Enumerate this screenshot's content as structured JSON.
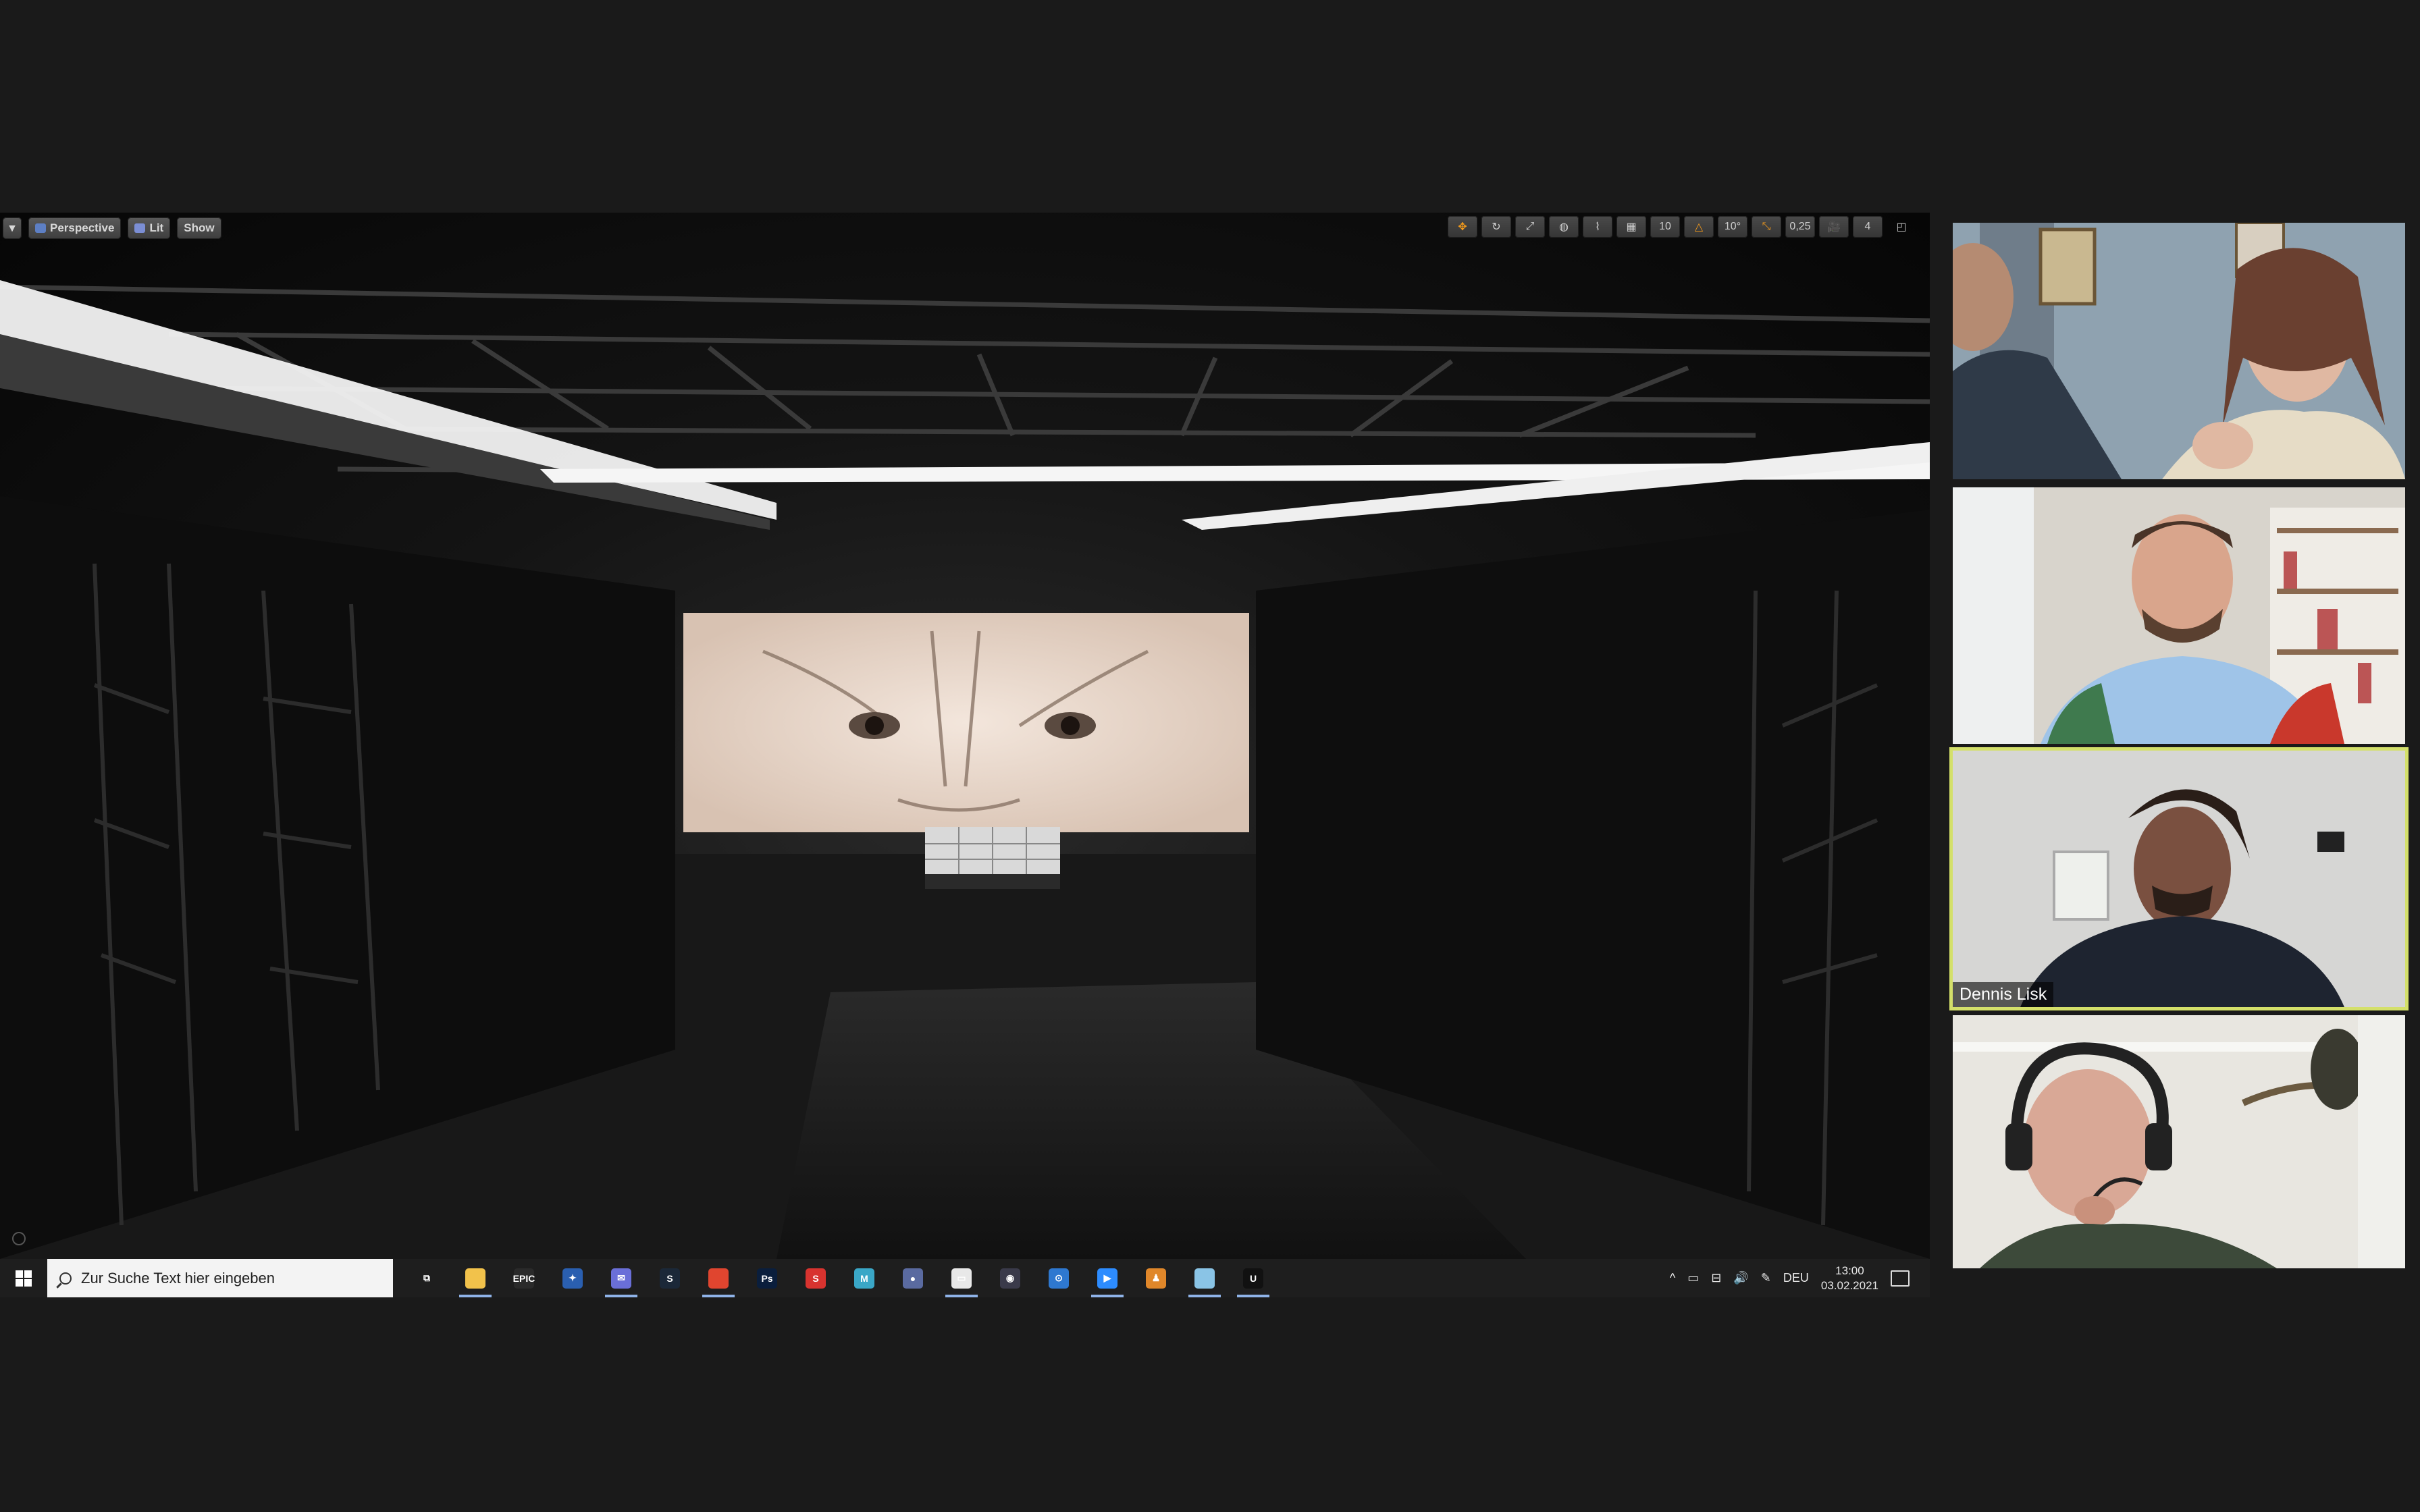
{
  "viewport": {
    "toolbar_left": {
      "dropdown_icon": "chevron-down-icon",
      "perspective_label": "Perspective",
      "lit_label": "Lit",
      "show_label": "Show"
    },
    "toolbar_right": {
      "grid_snap": "10",
      "rotation_snap": "10°",
      "scale_snap": "0,25",
      "camera_speed": "4"
    }
  },
  "taskbar": {
    "search_placeholder": "Zur Suche Text hier eingeben",
    "language": "DEU",
    "time": "13:00",
    "date": "03.02.2021",
    "apps": [
      {
        "name": "task-view-icon",
        "label": "⧉",
        "color": "#1e1e1e"
      },
      {
        "name": "file-explorer-icon",
        "label": "",
        "color": "#f2c24b",
        "active": true
      },
      {
        "name": "epic-games-icon",
        "label": "EPIC",
        "color": "#2a2a2a"
      },
      {
        "name": "app-blue-gear-icon",
        "label": "✦",
        "color": "#2a5fb0"
      },
      {
        "name": "mail-icon",
        "label": "✉",
        "color": "#6a6fd8",
        "active": true
      },
      {
        "name": "steam-icon",
        "label": "S",
        "color": "#1b2838"
      },
      {
        "name": "chrome-icon",
        "label": "",
        "color": "#e0452f",
        "active": true
      },
      {
        "name": "photoshop-icon",
        "label": "Ps",
        "color": "#0a1e3c"
      },
      {
        "name": "substance-icon",
        "label": "S",
        "color": "#d8332f"
      },
      {
        "name": "m-app-icon",
        "label": "M",
        "color": "#3aa7c7"
      },
      {
        "name": "obs-icon",
        "label": "●",
        "color": "#5a6aa0"
      },
      {
        "name": "oculus-icon",
        "label": "▭",
        "color": "#e8e8e8",
        "active": true
      },
      {
        "name": "app-dark-icon",
        "label": "◉",
        "color": "#3a3a4a"
      },
      {
        "name": "app-blue-circle-icon",
        "label": "⊙",
        "color": "#2e78d0"
      },
      {
        "name": "zoom-icon",
        "label": "▶",
        "color": "#2d8cff",
        "active": true
      },
      {
        "name": "app-orange-icon",
        "label": "♟",
        "color": "#e0872a"
      },
      {
        "name": "notepad-icon",
        "label": "",
        "color": "#8ac4e6",
        "active": true
      },
      {
        "name": "unreal-engine-icon",
        "label": "U",
        "color": "#111111",
        "active": true
      }
    ]
  },
  "participants": [
    {
      "name": "",
      "active": false
    },
    {
      "name": "",
      "active": false
    },
    {
      "name": "Dennis Lisk",
      "active": true
    },
    {
      "name": "",
      "active": false
    }
  ]
}
